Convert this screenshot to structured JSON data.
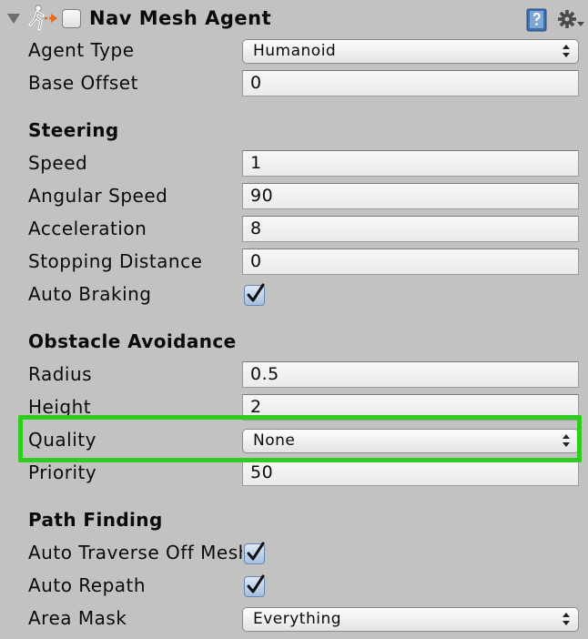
{
  "component": {
    "title": "Nav Mesh Agent",
    "icons": [
      "foldout-arrow-icon",
      "nav-mesh-agent-icon",
      "help-book-icon",
      "gear-icon"
    ]
  },
  "fields": {
    "agent_type": {
      "label": "Agent Type",
      "value": "Humanoid"
    },
    "base_offset": {
      "label": "Base Offset",
      "value": "0"
    }
  },
  "steering": {
    "title": "Steering",
    "speed": {
      "label": "Speed",
      "value": "1"
    },
    "angular_speed": {
      "label": "Angular Speed",
      "value": "90"
    },
    "acceleration": {
      "label": "Acceleration",
      "value": "8"
    },
    "stopping_distance": {
      "label": "Stopping Distance",
      "value": "0"
    },
    "auto_braking": {
      "label": "Auto Braking",
      "checked": true
    }
  },
  "obstacle_avoidance": {
    "title": "Obstacle Avoidance",
    "radius": {
      "label": "Radius",
      "value": "0.5"
    },
    "height": {
      "label": "Height",
      "value": "2"
    },
    "quality": {
      "label": "Quality",
      "value": "None"
    },
    "priority": {
      "label": "Priority",
      "value": "50"
    }
  },
  "path_finding": {
    "title": "Path Finding",
    "auto_traverse": {
      "label": "Auto Traverse Off Mesh Link",
      "checked": true
    },
    "auto_repath": {
      "label": "Auto Repath",
      "checked": true
    },
    "area_mask": {
      "label": "Area Mask",
      "value": "Everything"
    }
  },
  "colors": {
    "panel_bg": "#c2c2c2",
    "highlight": "#2fcc1f",
    "checkbox_blue": "#a5bedf"
  }
}
